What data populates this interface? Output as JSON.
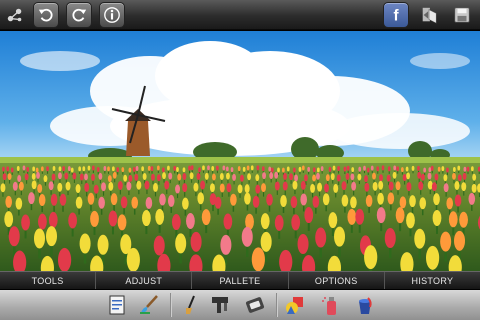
{
  "toolbar": {
    "left_icons": [
      "share-icon",
      "undo-icon",
      "redo-icon",
      "info-icon"
    ],
    "right_icons": [
      "facebook-icon",
      "crop-icon",
      "save-icon"
    ],
    "facebook_glyph": "f"
  },
  "menu": {
    "tabs": [
      "TOOLS",
      "ADJUST",
      "PALLETE",
      "OPTIONS",
      "HISTORY"
    ]
  },
  "tray": {
    "icons": [
      "document-icon",
      "paint-brush-icon",
      "brush-icon",
      "stamp-icon",
      "eraser-icon",
      "shapes-icon",
      "spray-can-icon",
      "paint-bucket-icon"
    ]
  },
  "colors": {
    "sky": "#2f8fd8",
    "cloud": "#ffffff",
    "grass": "#5ea23a",
    "tulip_red": "#e23a4a",
    "tulip_yellow": "#f2dc3a",
    "tulip_pink": "#f27a8a",
    "facebook_blue": "#3b5998"
  }
}
